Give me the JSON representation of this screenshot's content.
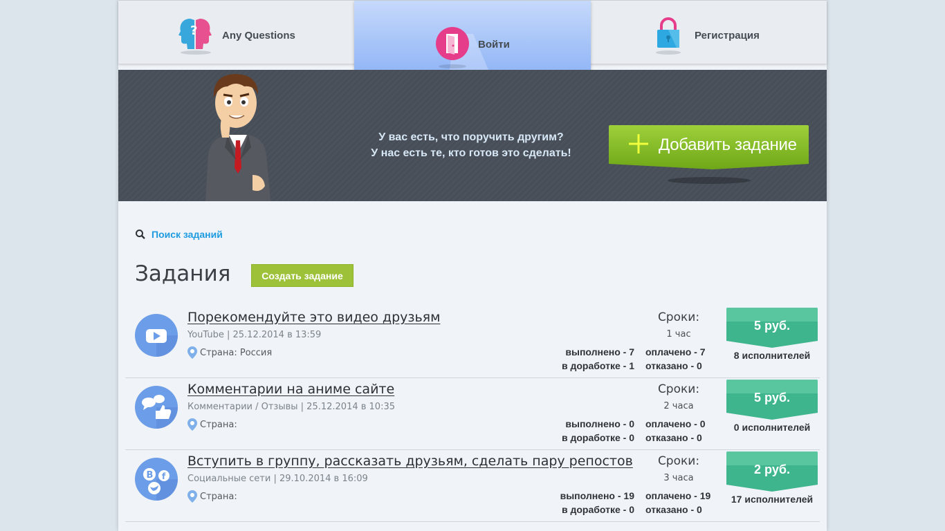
{
  "nav": {
    "items": [
      {
        "label": "Any Questions",
        "icon": "heads-question-icon"
      },
      {
        "label": "Войти",
        "icon": "door-icon"
      },
      {
        "label": "Регистрация",
        "icon": "lock-icon"
      }
    ]
  },
  "banner": {
    "line1": "У вас есть, что поручить другим?",
    "line2": "У нас есть те, кто готов это сделать!",
    "add_button": "Добавить задание"
  },
  "search": {
    "label": "Поиск заданий"
  },
  "main": {
    "title": "Задания",
    "create_button": "Создать задание",
    "deadline_heading": "Сроки:"
  },
  "tasks": [
    {
      "title": "Порекомендуйте это видео друзьям",
      "meta": "YouTube | 25.12.2014 в 13:59",
      "country": "Страна: Россия",
      "deadline": "1 час",
      "done": "выполнено - 7",
      "paid": "оплачено - 7",
      "rework": "в доработке - 1",
      "refused": "отказано - 0",
      "price": "5 руб.",
      "performers": "8 исполнителей",
      "icon": "youtube-icon"
    },
    {
      "title": "Комментарии на аниме сайте",
      "meta": "Комментарии / Отзывы | 25.12.2014 в 10:35",
      "country": "Страна:",
      "deadline": "2 часа",
      "done": "выполнено - 0",
      "paid": "оплачено - 0",
      "rework": "в доработке - 0",
      "refused": "отказано - 0",
      "price": "5 руб.",
      "performers": "0 исполнителей",
      "icon": "comments-like-icon"
    },
    {
      "title": "Вступить в группу, рассказать друзьям, сделать пару репостов",
      "meta": "Социальные сети | 29.10.2014 в 16:09",
      "country": "Страна:",
      "deadline": "3 часа",
      "done": "выполнено - 19",
      "paid": "оплачено - 19",
      "rework": "в доработке - 0",
      "refused": "отказано - 0",
      "price": "2 руб.",
      "performers": "17 исполнителей",
      "icon": "social-networks-icon"
    }
  ],
  "colors": {
    "accent_blue": "#1e9be0",
    "green_button": "#9dc23a",
    "price_teal": "#3fb58d",
    "nav_active": "#8eb3f6",
    "banner_bg": "#4b525c"
  }
}
